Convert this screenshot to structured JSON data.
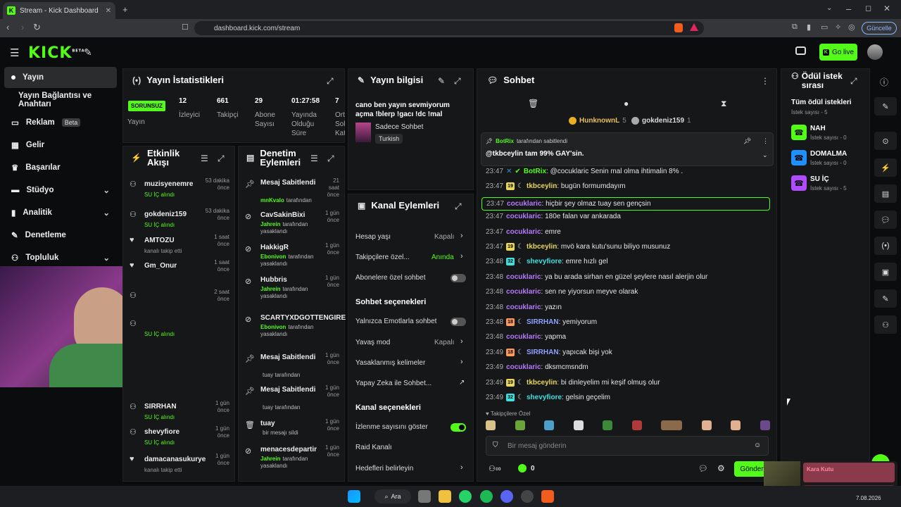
{
  "browser": {
    "tab_title": "Stream - Kick Dashboard",
    "url": "dashboard.kick.com/stream",
    "update_label": "Güncelle"
  },
  "header": {
    "logo": "KICK",
    "logo_badge": "BETA",
    "go_live_label": "Go live"
  },
  "sidebar": {
    "items": [
      {
        "label": "Yayın"
      },
      {
        "label": "Yayın Bağlantısı ve Anahtarı"
      },
      {
        "label": "Reklam",
        "badge": "Beta"
      },
      {
        "label": "Gelir"
      },
      {
        "label": "Başarılar"
      },
      {
        "label": "Stüdyo"
      },
      {
        "label": "Analitik"
      },
      {
        "label": "Denetleme"
      },
      {
        "label": "Topluluk"
      }
    ]
  },
  "stats": {
    "title": "Yayın İstatistikleri",
    "status_badge": "SORUNSUZ",
    "status_label": "Yayın",
    "items": [
      {
        "value": "12",
        "label": "İzleyici"
      },
      {
        "value": "661",
        "label": "Takipçi"
      },
      {
        "value": "29",
        "label": "Abone Sayısı"
      },
      {
        "value": "01:27:58",
        "label": "Yayında Olduğu Süre"
      },
      {
        "value": "7",
        "label": "Ort Sol Kat"
      }
    ]
  },
  "stream_info": {
    "title": "Yayın bilgisi",
    "stream_title": "cano ben yayın sevmiyorum açma !blerp !gacı !dc !mal",
    "category": "Sadece Sohbet",
    "language": "Turkish"
  },
  "activity": {
    "title": "Etkinlik Akışı",
    "items": [
      {
        "user": "muzisyenemre",
        "sub": "SU İÇ alındı",
        "time": "53 dakika önce"
      },
      {
        "user": "gokdeniz159",
        "sub": "SU İÇ alındı",
        "time": "53 dakika önce"
      },
      {
        "user": "AMTOZU",
        "sub": "kanalı takip etti",
        "time": "1 saat önce"
      },
      {
        "user": "Gm_Onur",
        "sub": "",
        "time": "1 saat önce"
      },
      {
        "user": "",
        "sub": "",
        "time": "2 saat önce"
      },
      {
        "user": "",
        "sub": "SU İÇ alındı",
        "time": ""
      },
      {
        "user": "SIRRHAN",
        "sub": "SU İÇ alındı",
        "time": "1 gün önce"
      },
      {
        "user": "shevyfiore",
        "sub": "SU İÇ alındı",
        "time": "1 gün önce"
      },
      {
        "user": "damacanasukurye",
        "sub": "kanalı takip etti",
        "time": "1 gün önce"
      }
    ]
  },
  "moderation": {
    "title": "Denetim Eylemleri",
    "items": [
      {
        "action": "Mesaj Sabitlendi",
        "sub_user": "mnKvalo",
        "sub_text": "tarafından",
        "time": "21 saat önce"
      },
      {
        "action": "CavSakinBixi",
        "sub_user": "Jahrein",
        "sub_text": "tarafından yasaklandı",
        "time": "1 gün önce"
      },
      {
        "action": "HakkigR",
        "sub_user": "Ebonivon",
        "sub_text": "tarafından yasaklandı",
        "time": "1 gün önce"
      },
      {
        "action": "Hubbris",
        "sub_user": "Jahrein",
        "sub_text": "tarafından yasaklandı",
        "time": "1 gün önce"
      },
      {
        "action": "SCARTYXDGOTTENGIRE",
        "sub_user": "Ebonivon",
        "sub_text": "tarafından yasaklandı",
        "time": ""
      },
      {
        "action": "Mesaj Sabitlendi",
        "sub_user": "",
        "sub_text": "tuay tarafından",
        "time": "1 gün önce"
      },
      {
        "action": "Mesaj Sabitlendi",
        "sub_user": "",
        "sub_text": "tuay tarafından",
        "time": "1 gün önce"
      },
      {
        "action": "tuay",
        "sub_user": "",
        "sub_text": "bir mesajı sildi",
        "time": "1 gün önce"
      },
      {
        "action": "menacesdepartir",
        "sub_user": "Jahrein",
        "sub_text": "tarafından yasaklandı",
        "time": "1 gün önce"
      }
    ]
  },
  "channel_actions": {
    "title": "Kanal Eylemleri",
    "rows": [
      {
        "label": "Hesap yaşı",
        "value": "Kapalı"
      },
      {
        "label": "Takipçilere özel...",
        "value": "Anında"
      },
      {
        "label": "Abonelere özel sohbet",
        "value": ""
      }
    ],
    "chat_options_title": "Sohbet seçenekleri",
    "chat_rows": [
      {
        "label": "Yalnızca Emotlarla sohbet",
        "value": ""
      },
      {
        "label": "Yavaş mod",
        "value": "Kapalı"
      },
      {
        "label": "Yasaklanmış kelimeler",
        "value": ""
      },
      {
        "label": "Yapay Zeka ile Sohbet...",
        "value": ""
      }
    ],
    "channel_options_title": "Kanal seçenekleri",
    "channel_rows": [
      {
        "label": "İzlenme sayısını göster",
        "value": ""
      },
      {
        "label": "Raid Kanalı",
        "value": ""
      },
      {
        "label": "Hedefleri belirleyin",
        "value": ""
      }
    ]
  },
  "chat": {
    "title": "Sohbet",
    "top_users": [
      {
        "name": "HunknownL",
        "count": "5"
      },
      {
        "name": "gokdeniz159",
        "count": "1"
      }
    ],
    "pinned": {
      "by": "BotRix",
      "by_text": "tarafından sabitlendi",
      "message": "@tkbceylin tam 99% GAY'sin."
    },
    "messages": [
      {
        "time": "23:47",
        "level": "",
        "user": "BotRix",
        "color": "c-green",
        "text": "@cocuklaric Senin mal olma ihtimalin 8% ."
      },
      {
        "time": "23:47",
        "level": "19",
        "user": "tkbceylin",
        "color": "c-yellow",
        "text": "bugün formumdayım"
      },
      {
        "time": "23:47",
        "level": "",
        "user": "cocuklaric",
        "color": "c-purple",
        "text": "hiçbir şey olmaz tuay sen gençsin"
      },
      {
        "time": "23:47",
        "level": "",
        "user": "cocuklaric",
        "color": "c-purple",
        "text": "180e falan var ankarada"
      },
      {
        "time": "23:47",
        "level": "",
        "user": "cocuklaric",
        "color": "c-purple",
        "text": "emre"
      },
      {
        "time": "23:47",
        "level": "19",
        "user": "tkbceylin",
        "color": "c-yellow",
        "text": "mvö kara kutu'sunu biliyo musunuz"
      },
      {
        "time": "23:48",
        "level": "32",
        "user": "shevyfiore",
        "color": "c-cyan",
        "text": "emre hızlı gel"
      },
      {
        "time": "23:48",
        "level": "",
        "user": "cocuklaric",
        "color": "c-purple",
        "text": "ya bu arada sirhan en güzel şeylere nasıl alerjin olur"
      },
      {
        "time": "23:48",
        "level": "",
        "user": "cocuklaric",
        "color": "c-purple",
        "text": "sen ne yiyorsun meyve olarak"
      },
      {
        "time": "23:48",
        "level": "",
        "user": "cocuklaric",
        "color": "c-purple",
        "text": "yazın"
      },
      {
        "time": "23:48",
        "level": "18",
        "user": "SIRRHAN",
        "color": "c-blue",
        "text": "yemiyorum"
      },
      {
        "time": "23:48",
        "level": "",
        "user": "cocuklaric",
        "color": "c-purple",
        "text": "yapma"
      },
      {
        "time": "23:49",
        "level": "18",
        "user": "SIRRHAN",
        "color": "c-blue",
        "text": "yapıcak bişi yok"
      },
      {
        "time": "23:49",
        "level": "",
        "user": "cocuklaric",
        "color": "c-purple",
        "text": "dksmcmsndm"
      },
      {
        "time": "23:49",
        "level": "19",
        "user": "tkbceylin",
        "color": "c-yellow",
        "text": "bi dinleyelim mi keşif olmuş olur"
      },
      {
        "time": "23:49",
        "level": "32",
        "user": "shevyfiore",
        "color": "c-cyan",
        "text": "gelsin geçelim"
      }
    ],
    "mode_label": "Takipçilere Özel",
    "input_placeholder": "Bir mesaj gönderin",
    "kicks_count": "0",
    "send_label": "Gönder"
  },
  "rewards": {
    "title": "Ödül istek sırası",
    "all_label": "Tüm ödül istekleri",
    "count_label": "İstek sayısı - 5",
    "items": [
      {
        "name": "NAH",
        "count": "İstek sayısı - 0",
        "color": "#53fc18"
      },
      {
        "name": "DOMALMA",
        "count": "İstek sayısı - 0",
        "color": "#1e90ff"
      },
      {
        "name": "SU İÇ",
        "count": "İstek sayısı - 5",
        "color": "#b04cff"
      }
    ]
  },
  "media": {
    "title": "Kara Kutu"
  },
  "taskbar": {
    "search_label": "Ara",
    "date": "7.08.2026"
  },
  "colors": {
    "accent": "#53fc18",
    "background": "#0b0c0d",
    "panel": "#161719"
  }
}
